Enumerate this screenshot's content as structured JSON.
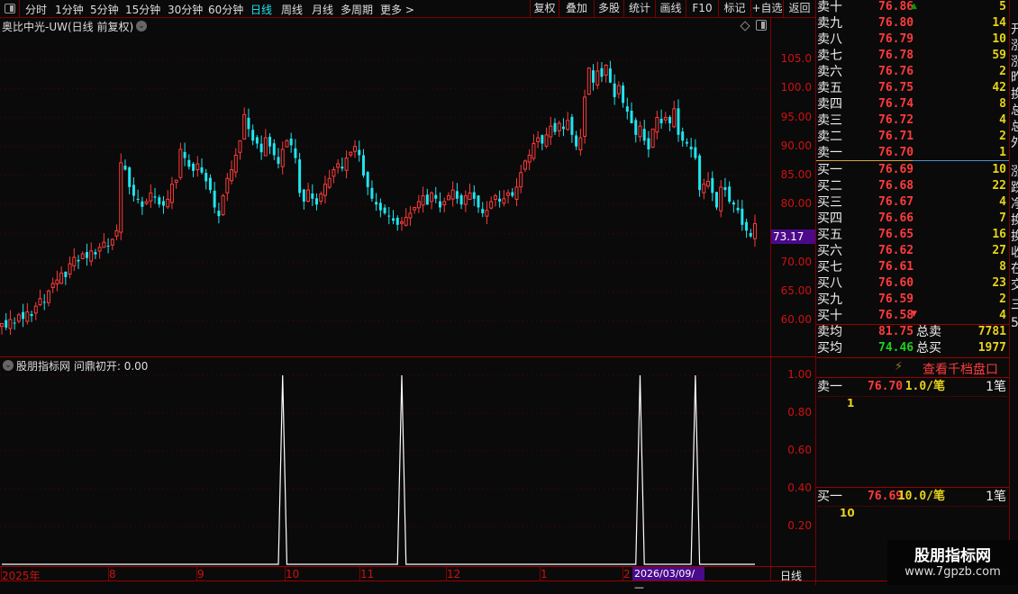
{
  "toolbar": {
    "tabs": [
      "分时",
      "1分钟",
      "5分钟",
      "15分钟",
      "30分钟",
      "60分钟",
      "日线",
      "周线",
      "月线",
      "多周期",
      "更多 >"
    ],
    "active_tab": "日线",
    "buttons": [
      "复权",
      "叠加",
      "多股",
      "统计",
      "画线",
      "F10",
      "标记",
      "+自选",
      "返回"
    ]
  },
  "chart": {
    "title": "奥比中光-UW(日线 前复权)",
    "price_ticks": [
      "105.0",
      "100.0",
      "95.00",
      "90.00",
      "85.00",
      "80.00",
      "70.00",
      "65.00",
      "60.00"
    ],
    "current_price_label": "73.17",
    "up_color": "#ff3b3b",
    "down_color": "#1ee6f0",
    "closes": [
      59.5,
      58.8,
      60.2,
      59.6,
      61.0,
      60.3,
      61.5,
      60.8,
      62.5,
      63.8,
      63.2,
      65.1,
      66.4,
      67.0,
      68.2,
      67.5,
      69.8,
      70.9,
      70.2,
      71.5,
      70.8,
      72.0,
      71.4,
      72.6,
      73.5,
      72.9,
      74.0,
      75.5,
      87.2,
      86.0,
      83.0,
      81.5,
      80.8,
      79.6,
      80.5,
      82.0,
      81.2,
      80.0,
      79.8,
      80.9,
      83.5,
      84.2,
      89.5,
      88.0,
      86.5,
      85.8,
      87.0,
      85.5,
      84.0,
      82.5,
      79.5,
      78.0,
      81.5,
      84.5,
      86.0,
      88.5,
      91.0,
      95.5,
      93.0,
      91.0,
      90.5,
      89.0,
      91.5,
      90.0,
      88.5,
      87.0,
      89.5,
      91.0,
      90.2,
      88.0,
      82.0,
      80.5,
      82.5,
      81.0,
      80.0,
      81.8,
      83.5,
      84.5,
      86.0,
      87.0,
      86.2,
      88.0,
      89.0,
      90.0,
      88.5,
      85.0,
      83.0,
      81.0,
      80.0,
      79.0,
      78.5,
      78.0,
      77.2,
      76.5,
      77.0,
      77.8,
      78.5,
      79.5,
      80.5,
      81.5,
      80.0,
      82.0,
      81.0,
      79.5,
      80.5,
      81.5,
      82.5,
      81.0,
      80.0,
      81.5,
      82.0,
      81.0,
      79.5,
      78.5,
      79.0,
      80.5,
      81.5,
      80.5,
      81.0,
      82.0,
      81.5,
      83.0,
      85.5,
      87.5,
      88.5,
      90.5,
      91.5,
      90.5,
      92.0,
      93.5,
      92.5,
      94.0,
      93.0,
      94.5,
      92.0,
      90.0,
      91.5,
      98.5,
      103.5,
      101.0,
      103.0,
      102.0,
      104.0,
      101.0,
      98.5,
      100.5,
      97.5,
      96.0,
      94.0,
      92.0,
      93.5,
      91.0,
      89.5,
      93.0,
      95.0,
      94.0,
      95.0,
      94.0,
      96.5,
      92.0,
      91.0,
      90.5,
      89.5,
      88.0,
      82.5,
      83.5,
      84.0,
      82.0,
      79.5,
      83.0,
      82.5,
      80.5,
      80.0,
      79.0,
      76.5,
      75.5,
      74.5,
      76.7
    ],
    "ylim": [
      58,
      107
    ]
  },
  "indicator": {
    "header_icon": "chevron-down-icon",
    "name": "股朋指标网",
    "label": "问鼎初开: 0.00",
    "ticks": [
      "1.00",
      "0.80",
      "0.60",
      "0.40",
      "0.20"
    ],
    "ylim": [
      0,
      1
    ],
    "signal_candles": [
      66,
      94,
      150,
      163
    ]
  },
  "date_axis": {
    "labels": [
      "2025年",
      "8",
      "9",
      "10",
      "11",
      "12",
      "1",
      "2"
    ],
    "cursor_date": "2026/03/09/—",
    "period": "日线"
  },
  "orderbook": {
    "asks": [
      {
        "l": "卖十",
        "p": "76.86",
        "v": "5"
      },
      {
        "l": "卖九",
        "p": "76.80",
        "v": "14"
      },
      {
        "l": "卖八",
        "p": "76.79",
        "v": "10"
      },
      {
        "l": "卖七",
        "p": "76.78",
        "v": "59"
      },
      {
        "l": "卖六",
        "p": "76.76",
        "v": "2"
      },
      {
        "l": "卖五",
        "p": "76.75",
        "v": "42"
      },
      {
        "l": "卖四",
        "p": "76.74",
        "v": "8"
      },
      {
        "l": "卖三",
        "p": "76.72",
        "v": "4"
      },
      {
        "l": "卖二",
        "p": "76.71",
        "v": "2"
      },
      {
        "l": "卖一",
        "p": "76.70",
        "v": "1"
      }
    ],
    "bids": [
      {
        "l": "买一",
        "p": "76.69",
        "v": "10"
      },
      {
        "l": "买二",
        "p": "76.68",
        "v": "22"
      },
      {
        "l": "买三",
        "p": "76.67",
        "v": "4"
      },
      {
        "l": "买四",
        "p": "76.66",
        "v": "7"
      },
      {
        "l": "买五",
        "p": "76.65",
        "v": "16"
      },
      {
        "l": "买六",
        "p": "76.62",
        "v": "27"
      },
      {
        "l": "买七",
        "p": "76.61",
        "v": "8"
      },
      {
        "l": "买八",
        "p": "76.60",
        "v": "23"
      },
      {
        "l": "买九",
        "p": "76.59",
        "v": "2"
      },
      {
        "l": "买十",
        "p": "76.58",
        "v": "4"
      }
    ],
    "ask_avg_label": "卖均",
    "ask_avg": "81.75",
    "ask_total_label": "总卖",
    "ask_total": "7781",
    "bid_avg_label": "买均",
    "bid_avg": "74.46",
    "bid_total_label": "总买",
    "bid_total": "1977",
    "depth_link": "查看千档盘口",
    "queue_ask": {
      "l": "卖一",
      "p": "76.70",
      "avg": "1.0/笔",
      "count": "1笔",
      "orders": "1"
    },
    "queue_bid": {
      "l": "买一",
      "p": "76.69",
      "avg": "10.0/笔",
      "count": "1笔",
      "orders": "10"
    }
  },
  "right_strip": [
    "开",
    "涨",
    "涨",
    "昨",
    "换",
    "总",
    "总",
    "外",
    "涨",
    "跌",
    "净",
    "换",
    "换",
    "收",
    "在",
    "交",
    "三",
    "5"
  ],
  "watermark": {
    "title": "股朋指标网",
    "url": "www.7gpzb.com"
  }
}
